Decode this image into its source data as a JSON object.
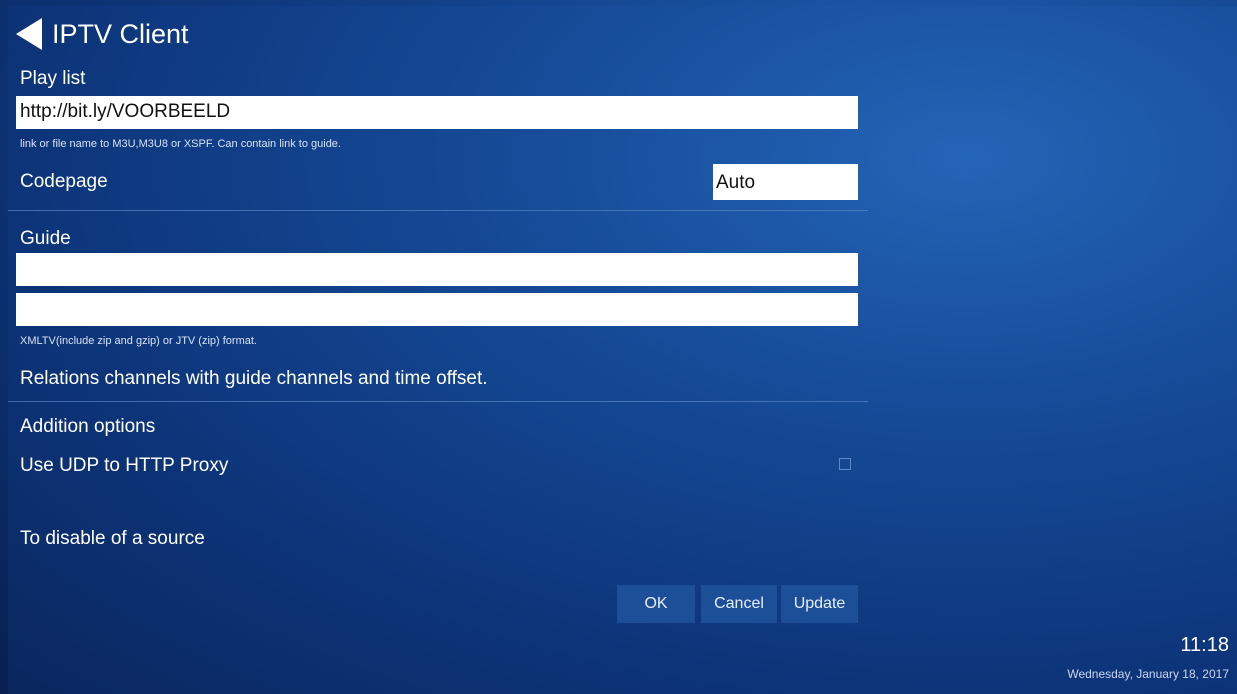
{
  "header": {
    "title": "IPTV Client"
  },
  "playlist": {
    "label": "Play list",
    "value": "http://bit.ly/VOORBEELD",
    "hint": "link or file name to M3U,M3U8 or XSPF. Can contain link to guide."
  },
  "codepage": {
    "label": "Codepage",
    "value": "Auto"
  },
  "guide": {
    "label": "Guide",
    "field1_value": "",
    "field2_value": "",
    "hint": "XMLTV(include zip and gzip) or JTV (zip) format."
  },
  "relations": {
    "label": "Relations channels with guide channels and time offset."
  },
  "addition": {
    "label": "Addition options",
    "udp_proxy_label": "Use UDP to HTTP Proxy",
    "udp_proxy_checked": false,
    "disable_label": "To disable of a source"
  },
  "buttons": {
    "ok": "OK",
    "cancel": "Cancel",
    "update": "Update"
  },
  "status": {
    "time": "11:18",
    "date": "Wednesday, January 18, 2017"
  }
}
